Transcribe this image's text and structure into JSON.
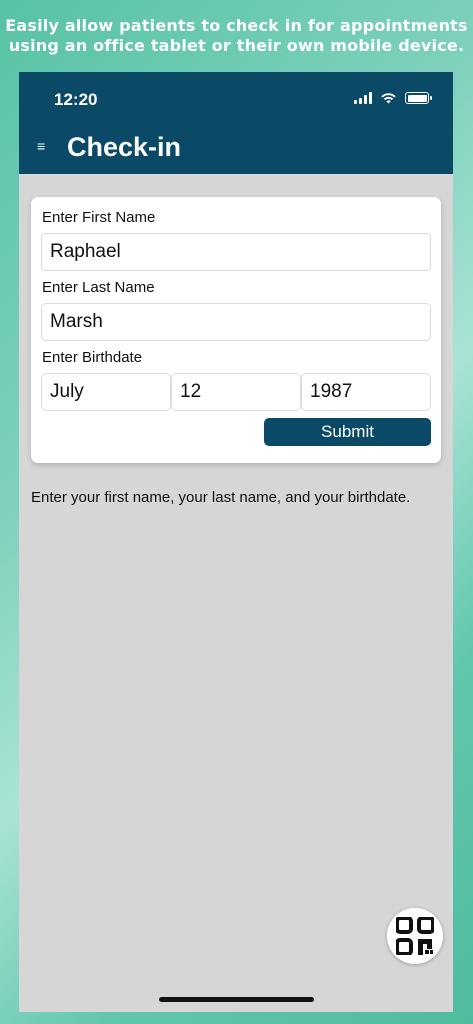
{
  "promo": {
    "line1": "Easily allow patients to check in for appointments",
    "line2": "using an office tablet or their own mobile device."
  },
  "status_bar": {
    "time": "12:20",
    "icons": [
      "signal-icon",
      "wifi-icon",
      "battery-icon"
    ]
  },
  "header": {
    "menu_icon": "≡",
    "title": "Check-in",
    "background": "#0b4a66"
  },
  "form": {
    "first_name_label": "Enter First Name",
    "first_name_value": "Raphael",
    "last_name_label": "Enter Last Name",
    "last_name_value": "Marsh",
    "birthdate_label": "Enter Birthdate",
    "birth_month": "July",
    "birth_day": "12",
    "birth_year": "1987",
    "submit_label": "Submit"
  },
  "helper_text": "Enter your first name, your last name, and your birthdate.",
  "fab": {
    "icon": "qr-code-icon"
  },
  "colors": {
    "accent": "#0b4a66",
    "content_bg": "#d6d6d6",
    "outer_bg": "#57c2a6"
  }
}
